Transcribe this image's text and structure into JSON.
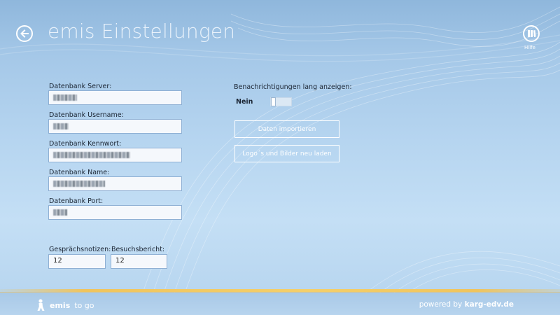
{
  "header": {
    "title": "emis Einstellungen",
    "back_icon": "back-arrow-icon",
    "help": {
      "label": "Hilfe",
      "icon": "book-icon"
    }
  },
  "form": {
    "server": {
      "label": "Datenbank Server:"
    },
    "username": {
      "label": "Datenbank Username:"
    },
    "password": {
      "label": "Datenbank Kennwort:"
    },
    "name": {
      "label": "Datenbank Name:"
    },
    "port": {
      "label": "Datenbank Port:"
    },
    "notes": {
      "label": "Gesprächsnotizen:",
      "value": "12"
    },
    "report": {
      "label": "Besuchsbericht:",
      "value": "12"
    }
  },
  "settings": {
    "notify_label": "Benachrichtigungen lang anzeigen:",
    "toggle_state": "Nein",
    "toggle_on": false,
    "import_button": "Daten importieren",
    "reload_button": "Logo´s und Bilder neu laden"
  },
  "footer": {
    "brand_name": "emis",
    "brand_suffix": "to go",
    "powered_prefix": "powered by",
    "powered_brand": "karg-edv.de"
  },
  "colors": {
    "background": "#b6d5f0",
    "accent_line": "#f0c45c",
    "header_text": "#e9f2fb"
  }
}
